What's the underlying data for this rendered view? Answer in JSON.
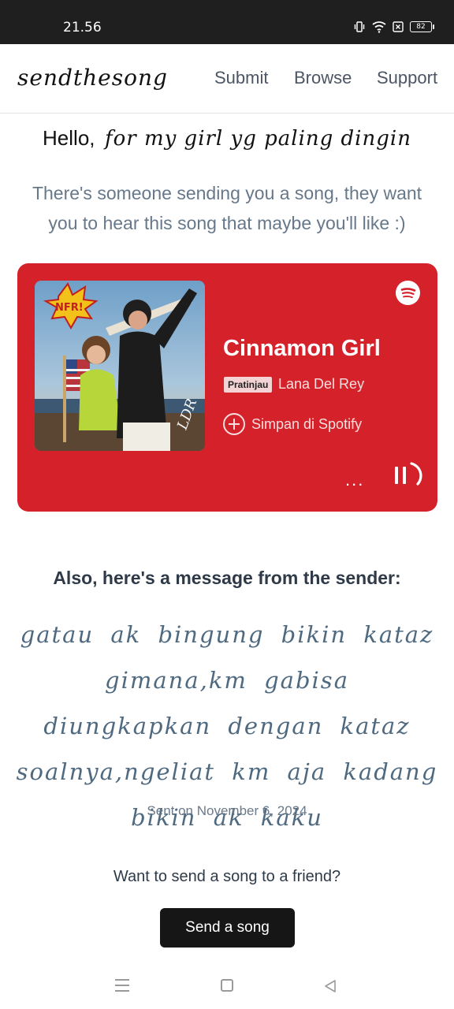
{
  "status_bar": {
    "time": "21.56",
    "battery": "82",
    "icons": [
      "vibrate-icon",
      "wifi-icon",
      "sim-icon",
      "battery-icon"
    ]
  },
  "header": {
    "logo": "sendthesong",
    "nav": [
      "Submit",
      "Browse",
      "Support"
    ]
  },
  "greeting": {
    "hello": "Hello,",
    "recipient": "for my girl yg paling dingin"
  },
  "intro": "There's someone sending you a song, they want you to hear this song that maybe you'll like :)",
  "player": {
    "background_color": "#d4212a",
    "title": "Cinnamon Girl",
    "preview_label": "Pratinjau",
    "artist": "Lana Del Rey",
    "save_label": "Simpan di Spotify",
    "more_label": "...",
    "cover_text": "NFR!",
    "cover_initials": "LDR"
  },
  "message": {
    "heading": "Also, here's a message from the sender:",
    "body": "gatau ak bingung bikin kataz gimana,km gabisa diungkapkan dengan kataz soalnya,ngeliat km aja kadang bikin ak kaku",
    "sent": "Sent on November 6, 2024"
  },
  "cta": {
    "text": "Want to send a song to a friend?",
    "button": "Send a song"
  }
}
